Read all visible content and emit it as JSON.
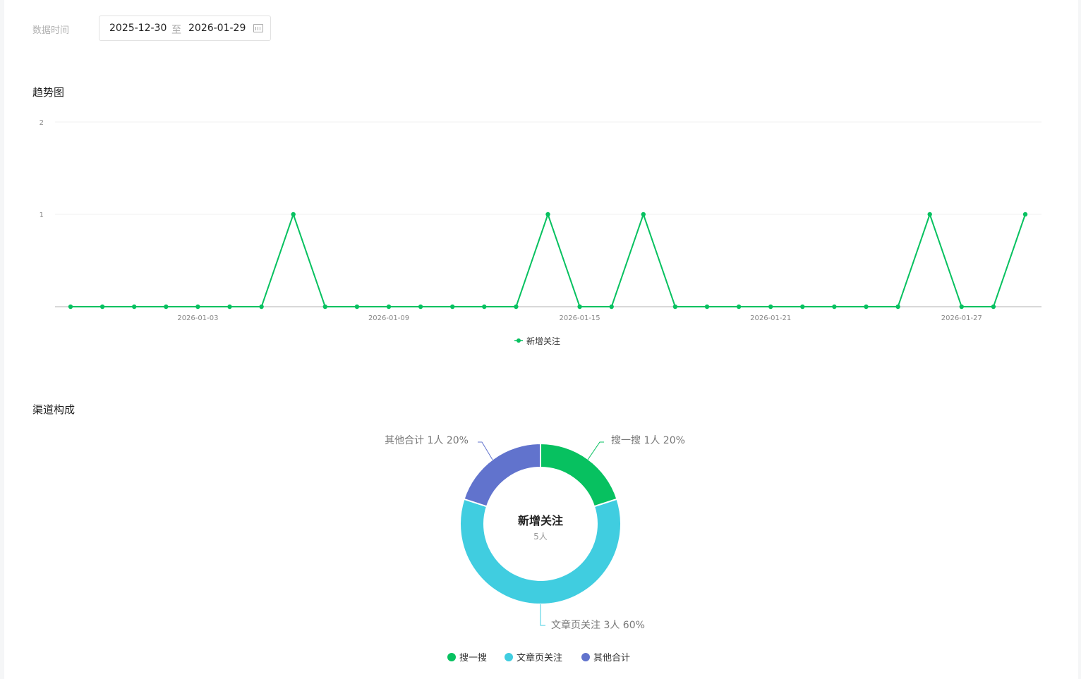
{
  "filter": {
    "label": "数据时间",
    "start": "2025-12-30",
    "separator": "至",
    "end": "2026-01-29"
  },
  "sections": {
    "trend": "趋势图",
    "channel": "渠道构成"
  },
  "chart_data": [
    {
      "type": "line",
      "title": "趋势图",
      "series": [
        {
          "name": "新增关注",
          "color": "#07c160",
          "values": [
            0,
            0,
            0,
            0,
            0,
            0,
            0,
            1,
            0,
            0,
            0,
            0,
            0,
            0,
            0,
            1,
            0,
            0,
            1,
            0,
            0,
            0,
            0,
            0,
            0,
            0,
            0,
            1,
            0,
            0,
            1
          ]
        }
      ],
      "x_start": "2025-12-30",
      "x_count": 31,
      "xticks": [
        {
          "index": 4,
          "label": "2026-01-03"
        },
        {
          "index": 10,
          "label": "2026-01-09"
        },
        {
          "index": 16,
          "label": "2026-01-15"
        },
        {
          "index": 22,
          "label": "2026-01-21"
        },
        {
          "index": 28,
          "label": "2026-01-27"
        }
      ],
      "yticks": [
        "1",
        "2"
      ],
      "ylim": [
        0,
        2
      ],
      "legend": "bottom"
    },
    {
      "type": "pie",
      "title": "渠道构成",
      "center_title": "新增关注",
      "center_value": "5人",
      "slices": [
        {
          "name": "搜一搜",
          "value": 1,
          "label": "搜一搜 1人 20%",
          "color": "#07c160"
        },
        {
          "name": "文章页关注",
          "value": 3,
          "label": "文章页关注 3人 60%",
          "color": "#40cde0"
        },
        {
          "name": "其他合计",
          "value": 1,
          "label": "其他合计 1人 20%",
          "color": "#6173cd"
        }
      ],
      "legend": "bottom"
    }
  ]
}
